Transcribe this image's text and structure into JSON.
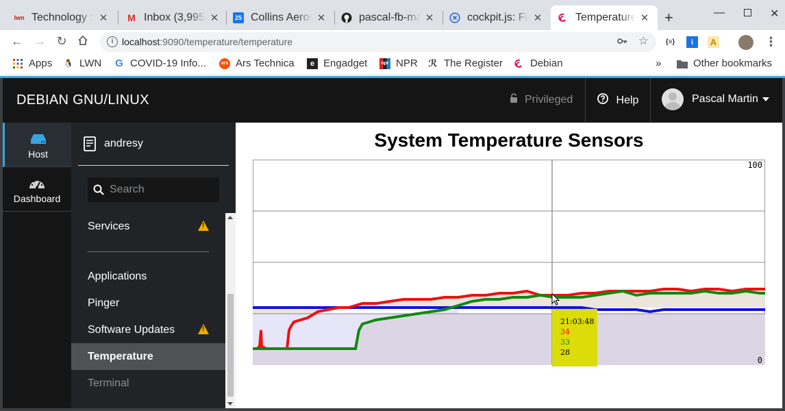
{
  "browser": {
    "tabs": [
      {
        "title": "Technology : N",
        "favicon": "lwn-icon"
      },
      {
        "title": "Inbox (3,995)",
        "favicon": "gmail-icon"
      },
      {
        "title": "Collins Aerosp",
        "favicon": "calendar-icon"
      },
      {
        "title": "pascal-fb-ma",
        "favicon": "github-icon"
      },
      {
        "title": "cockpit.js: File",
        "favicon": "x-circle-icon"
      },
      {
        "title": "Temperature",
        "favicon": "debian-icon"
      }
    ],
    "calendar_day": "25",
    "url_host": "localhost",
    "url_path": ":9090/temperature/temperature",
    "bookmarks": [
      "Apps",
      "LWN",
      "COVID-19 Info...",
      "Ars Technica",
      "Engadget",
      "NPR",
      "The Register",
      "Debian"
    ],
    "ars_badge": "ars",
    "npr_badge": "npr",
    "overflow": "»",
    "other_bookmarks": "Other bookmarks"
  },
  "cockpit": {
    "brand": "DEBIAN GNU/LINUX",
    "privileged": "Privileged",
    "help": "Help",
    "user": "Pascal Martin",
    "leftnav": [
      {
        "label": "Host",
        "icon": "server-icon",
        "active": true
      },
      {
        "label": "Dashboard",
        "icon": "dashboard-icon",
        "active": false
      }
    ],
    "hostname": "andresy",
    "search_placeholder": "Search",
    "menu": [
      {
        "label": "Services",
        "warning": true
      },
      {
        "label": "Applications",
        "warning": false
      },
      {
        "label": "Pinger",
        "warning": false
      },
      {
        "label": "Software Updates",
        "warning": true
      },
      {
        "label": "Temperature",
        "warning": false,
        "active": true
      },
      {
        "label": "Terminal",
        "warning": false
      }
    ]
  },
  "page": {
    "title": "System Temperature Sensors"
  },
  "chart_data": {
    "type": "line",
    "ylim": [
      0,
      100
    ],
    "y_tick_labels": [
      "100",
      "0"
    ],
    "grid": true,
    "colors": {
      "red": "#ee1111",
      "green": "#118811",
      "blue": "#1111dd",
      "fill_top": "#ebe5dc",
      "fill_bottom": "#dcd6e4",
      "fill_low": "#e6e6f8"
    },
    "series": [
      {
        "color": "red",
        "values": [
          3,
          3,
          3,
          3,
          3,
          15,
          3,
          3,
          3,
          3,
          3,
          3,
          3,
          3,
          3,
          3,
          3,
          3,
          3,
          3,
          3,
          3,
          3,
          3,
          3,
          3,
          3,
          3,
          3,
          3,
          3,
          3,
          3,
          3,
          3,
          3,
          3,
          3,
          3,
          3,
          3,
          3,
          3,
          3,
          3,
          3,
          3,
          3,
          3,
          3,
          3,
          3,
          3,
          3,
          3,
          3,
          3,
          3,
          3,
          3,
          3,
          3,
          3,
          3,
          3,
          3,
          3,
          3,
          3,
          3,
          3,
          3,
          3,
          3,
          3,
          3,
          3,
          3,
          3,
          3,
          3,
          3,
          3,
          3,
          3,
          3,
          3,
          3,
          3,
          3,
          3,
          3,
          3,
          3,
          3,
          3,
          3,
          3,
          3,
          3,
          3,
          3,
          3,
          3,
          3,
          3,
          3,
          3,
          3,
          3,
          3,
          3,
          3,
          3,
          3,
          3,
          3,
          3,
          3,
          3,
          3,
          3,
          3,
          3,
          3,
          3,
          3,
          3,
          3,
          3,
          3,
          3,
          3,
          3,
          3,
          3,
          3,
          3,
          3,
          3,
          3,
          3,
          3,
          3,
          3,
          3,
          3,
          3,
          3,
          3,
          3,
          3,
          3,
          3,
          3,
          3,
          3,
          3,
          3,
          3,
          3,
          3,
          3,
          3,
          3,
          3,
          3,
          3,
          3,
          3,
          3,
          3,
          3,
          3,
          3,
          3,
          3,
          3,
          3,
          3,
          3,
          3,
          3,
          3,
          3,
          3,
          3,
          3,
          3,
          3,
          3,
          3,
          3,
          3,
          3,
          3,
          3,
          3,
          3,
          3,
          3,
          3,
          3,
          3,
          3,
          3,
          3,
          3,
          3,
          3,
          3,
          3,
          3,
          3,
          3,
          3,
          3,
          3,
          3,
          3,
          3,
          3,
          3,
          3,
          3,
          3,
          3,
          3,
          3,
          3,
          3,
          3,
          3,
          3,
          3,
          3,
          3,
          3,
          3,
          3,
          3,
          3,
          3,
          3,
          3,
          3,
          3,
          3,
          3,
          3
        ]
      },
      {
        "color": "green",
        "values": [
          3,
          3,
          3,
          3,
          3,
          3,
          3,
          3,
          3,
          3,
          3,
          3,
          3,
          3,
          3,
          3,
          3,
          3,
          3,
          3,
          3,
          3,
          3,
          3,
          3,
          3,
          3,
          3,
          3,
          3,
          3,
          3,
          3,
          3,
          3,
          3,
          3,
          3,
          3,
          3,
          3,
          3,
          3,
          3,
          3,
          3,
          3,
          3,
          3,
          3,
          3,
          3,
          3,
          3,
          3,
          3,
          3,
          3,
          3,
          3,
          3,
          3,
          3,
          3,
          3,
          3,
          3,
          3,
          3,
          3,
          3,
          3,
          3,
          3,
          3,
          3,
          3,
          3,
          3,
          3,
          3,
          3,
          3,
          3,
          3,
          3,
          3,
          3,
          3,
          3,
          3,
          3,
          3,
          3,
          3,
          3,
          3,
          3,
          3,
          3,
          3,
          3,
          3,
          3,
          3,
          3,
          3,
          3,
          3,
          3,
          3,
          3,
          3,
          3,
          3,
          3,
          3,
          3,
          3,
          3,
          3,
          3,
          3,
          3,
          3,
          3,
          3,
          3,
          3,
          3,
          3,
          3,
          3,
          3,
          3,
          3,
          3,
          3,
          3,
          3,
          3,
          3,
          3,
          3,
          3,
          3,
          3,
          3,
          3,
          3,
          3,
          3,
          3,
          3,
          3,
          3,
          3,
          3,
          3,
          3,
          3,
          3,
          3,
          3,
          3,
          3,
          3,
          3,
          3,
          3,
          3,
          3,
          3,
          3,
          3,
          3,
          3,
          3,
          3,
          3,
          3,
          3,
          3,
          3,
          3,
          3,
          3,
          3,
          3,
          3,
          3,
          3,
          3,
          3,
          3,
          3,
          3,
          3,
          3,
          3,
          3,
          3,
          3,
          3,
          3,
          3,
          3,
          3,
          3,
          3,
          3,
          3,
          3,
          3,
          3,
          3,
          3,
          3,
          3,
          3,
          3,
          3,
          3,
          3,
          3,
          3,
          3,
          3,
          3,
          3,
          3,
          3,
          3,
          3,
          3,
          3,
          3,
          3,
          3,
          3,
          3,
          3,
          3,
          3,
          3,
          3,
          3,
          3,
          3,
          3
        ]
      },
      {
        "color": "blue",
        "values": [
          28,
          28,
          28
        ]
      }
    ],
    "red_points": [
      [
        0,
        8
      ],
      [
        6,
        8
      ],
      [
        10,
        9
      ],
      [
        12,
        17
      ],
      [
        13,
        9
      ],
      [
        20,
        8
      ],
      [
        45,
        8
      ],
      [
        50,
        8
      ],
      [
        53,
        17
      ],
      [
        56,
        19
      ],
      [
        60,
        21
      ],
      [
        70,
        22
      ],
      [
        80,
        23
      ],
      [
        95,
        26
      ],
      [
        110,
        27
      ],
      [
        125,
        28
      ],
      [
        140,
        28
      ],
      [
        160,
        30
      ],
      [
        180,
        30
      ],
      [
        200,
        31
      ],
      [
        220,
        32
      ],
      [
        240,
        32
      ],
      [
        260,
        32
      ],
      [
        280,
        33
      ],
      [
        300,
        33
      ],
      [
        320,
        34
      ],
      [
        340,
        34
      ],
      [
        360,
        35
      ],
      [
        380,
        35
      ],
      [
        400,
        36
      ],
      [
        420,
        34
      ],
      [
        440,
        34
      ],
      [
        460,
        34
      ],
      [
        480,
        35
      ],
      [
        500,
        35
      ],
      [
        520,
        36
      ],
      [
        540,
        36
      ],
      [
        560,
        36
      ],
      [
        580,
        36
      ],
      [
        600,
        37
      ],
      [
        620,
        37
      ],
      [
        640,
        36
      ],
      [
        660,
        37
      ],
      [
        680,
        37
      ],
      [
        700,
        36
      ],
      [
        720,
        37
      ],
      [
        740,
        37
      ],
      [
        748,
        37
      ]
    ],
    "green_points": [
      [
        0,
        8
      ],
      [
        10,
        8
      ],
      [
        20,
        8
      ],
      [
        40,
        8
      ],
      [
        60,
        8
      ],
      [
        80,
        8
      ],
      [
        100,
        8
      ],
      [
        120,
        8
      ],
      [
        140,
        8
      ],
      [
        150,
        8
      ],
      [
        155,
        17
      ],
      [
        160,
        20
      ],
      [
        170,
        21
      ],
      [
        180,
        22
      ],
      [
        200,
        23
      ],
      [
        220,
        24
      ],
      [
        240,
        25
      ],
      [
        260,
        26
      ],
      [
        280,
        27
      ],
      [
        300,
        29
      ],
      [
        320,
        31
      ],
      [
        340,
        32
      ],
      [
        360,
        32
      ],
      [
        380,
        33
      ],
      [
        400,
        33
      ],
      [
        420,
        34
      ],
      [
        440,
        33
      ],
      [
        460,
        33
      ],
      [
        480,
        33
      ],
      [
        500,
        34
      ],
      [
        520,
        35
      ],
      [
        540,
        36
      ],
      [
        560,
        34
      ],
      [
        580,
        35
      ],
      [
        600,
        35
      ],
      [
        620,
        35
      ],
      [
        640,
        35
      ],
      [
        660,
        36
      ],
      [
        680,
        35
      ],
      [
        700,
        35
      ],
      [
        720,
        36
      ],
      [
        740,
        35
      ],
      [
        748,
        35
      ]
    ],
    "blue_points": [
      [
        0,
        28
      ],
      [
        200,
        28
      ],
      [
        300,
        28
      ],
      [
        400,
        28
      ],
      [
        480,
        28
      ],
      [
        500,
        27
      ],
      [
        540,
        27
      ],
      [
        560,
        27
      ],
      [
        580,
        26
      ],
      [
        600,
        27
      ],
      [
        640,
        27
      ],
      [
        700,
        27
      ],
      [
        748,
        27
      ]
    ],
    "tooltip": {
      "time": "21:03:48",
      "values": [
        "34",
        "33",
        "28"
      ]
    }
  }
}
